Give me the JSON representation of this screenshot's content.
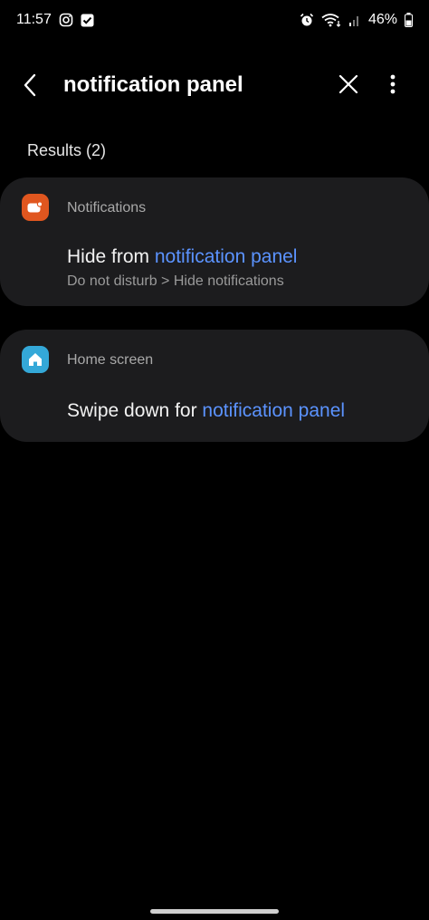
{
  "status_bar": {
    "time": "11:57",
    "battery": "46%",
    "icons": [
      "instagram-icon",
      "check-box-icon",
      "alarm-icon",
      "wifi-icon",
      "signal-icon",
      "battery-icon"
    ]
  },
  "search": {
    "query": "notification panel"
  },
  "results": {
    "label": "Results (2)",
    "items": [
      {
        "category": "Notifications",
        "title_prefix": "Hide from ",
        "title_highlight": "notification panel",
        "path": "Do not disturb > Hide notifications",
        "icon": "notifications-app-icon",
        "icon_color": "#e0561f"
      },
      {
        "category": "Home screen",
        "title_prefix": "Swipe down for ",
        "title_highlight": "notification panel",
        "icon": "home-screen-app-icon",
        "icon_color": "#34a8d8"
      }
    ]
  },
  "colors": {
    "background": "#000000",
    "card": "#1c1c1e",
    "highlight": "#5b93ff"
  }
}
